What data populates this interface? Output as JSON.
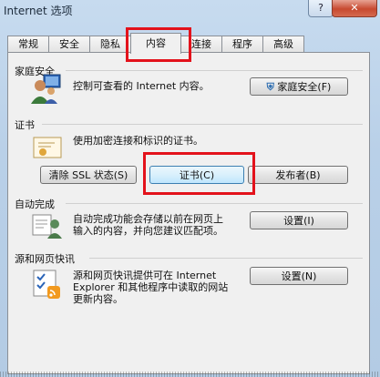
{
  "window": {
    "title": "Internet 选项",
    "help_label": "?",
    "close_label": "✕"
  },
  "tabs": [
    {
      "label": "常规"
    },
    {
      "label": "安全"
    },
    {
      "label": "隐私"
    },
    {
      "label": "内容"
    },
    {
      "label": "连接"
    },
    {
      "label": "程序"
    },
    {
      "label": "高级"
    }
  ],
  "active_tab": "内容",
  "family_safety": {
    "heading": "家庭安全",
    "description": "控制可查看的 Internet 内容。",
    "button": "家庭安全(F)"
  },
  "certificates": {
    "heading": "证书",
    "description": "使用加密连接和标识的证书。",
    "buttons": [
      "清除 SSL 状态(S)",
      "证书(C)",
      "发布者(B)"
    ]
  },
  "autocomplete": {
    "heading": "自动完成",
    "description_lines": [
      "自动完成功能会存储以前在网页上",
      "输入的内容，并向您建议匹配项。"
    ],
    "button": "设置(I)"
  },
  "feeds": {
    "heading": "源和网页快讯",
    "description_lines": [
      "源和网页快讯提供可在 Internet",
      "Explorer 和其他程序中读取的网站",
      "更新内容。"
    ],
    "button": "设置(N)"
  },
  "colors": {
    "highlight": "#e3121b",
    "focus_border": "#3c7fb1"
  }
}
